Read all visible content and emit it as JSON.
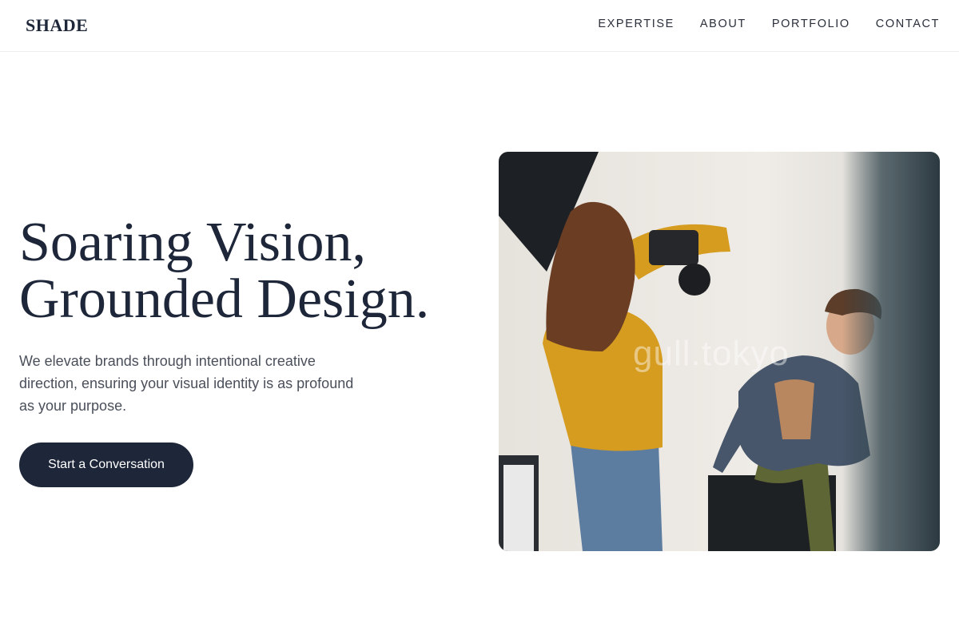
{
  "header": {
    "logo": "SHADE",
    "nav": [
      {
        "label": "EXPERTISE"
      },
      {
        "label": "ABOUT"
      },
      {
        "label": "PORTFOLIO"
      },
      {
        "label": "CONTACT"
      }
    ]
  },
  "hero": {
    "title_line1": "Soaring Vision,",
    "title_line2": "Grounded Design.",
    "description": "We elevate brands through intentional creative direction, ensuring your visual identity is as profound as your purpose.",
    "cta_label": "Start a Conversation"
  },
  "photo": {
    "watermark": "gull.tokyo",
    "subject": "photographer-shooting-model-photo"
  },
  "colors": {
    "primary": "#1e2739",
    "text_muted": "#4a4f5a",
    "background": "#ffffff"
  }
}
